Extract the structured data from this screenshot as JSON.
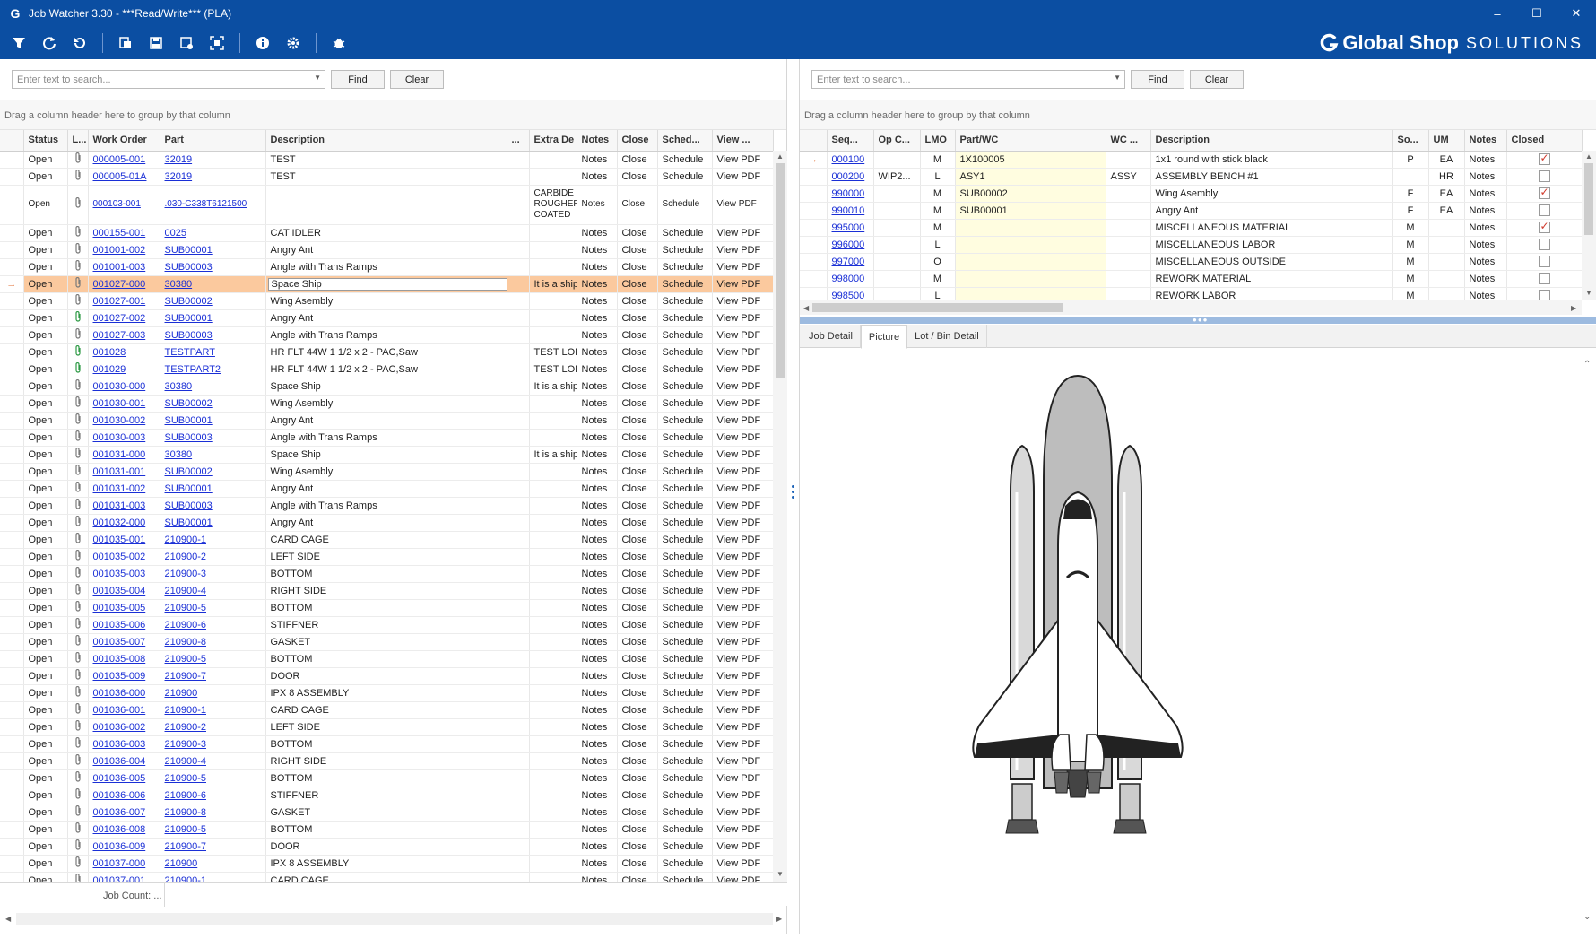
{
  "window": {
    "title": "Job Watcher 3.30 - ***Read/Write*** (PLA)",
    "app_icon": "G",
    "minimize": "–",
    "maximize": "☐",
    "close": "✕"
  },
  "toolbar": {
    "buttons": [
      "filter-icon",
      "refresh-icon",
      "undo-icon",
      "export-icon",
      "save-icon",
      "save-layout-icon",
      "fit-icon",
      "info-icon",
      "settings-icon",
      "bug-icon"
    ]
  },
  "brand": {
    "name": "Global Shop",
    "suffix": "SOLUTIONS"
  },
  "left": {
    "search": {
      "placeholder": "Enter text to search...",
      "find": "Find",
      "clear": "Clear"
    },
    "group_hint": "Drag a column header here to group by that column",
    "columns": [
      "Status",
      "L...",
      "Work Order",
      "Part",
      "Description",
      "...",
      "Extra De",
      "Notes",
      "Close",
      "Sched...",
      "View ..."
    ],
    "rows": [
      {
        "status": "Open",
        "clip": "gray",
        "wo": "000005-001",
        "part": "32019",
        "desc": "TEST",
        "extra": ""
      },
      {
        "status": "Open",
        "clip": "gray",
        "wo": "000005-01A",
        "part": "32019",
        "desc": "TEST",
        "extra": ""
      },
      {
        "status": "Open",
        "clip": "gray",
        "wo": "000103-001",
        "part": ".030-C338T6121500",
        "desc": "",
        "extra": "CARBIDE ROUGHER COATED",
        "tall": true
      },
      {
        "status": "Open",
        "clip": "gray",
        "wo": "000155-001",
        "part": "0025",
        "desc": "CAT IDLER",
        "extra": ""
      },
      {
        "status": "Open",
        "clip": "gray",
        "wo": "001001-002",
        "part": "SUB00001",
        "desc": "Angry Ant",
        "extra": ""
      },
      {
        "status": "Open",
        "clip": "gray",
        "wo": "001001-003",
        "part": "SUB00003",
        "desc": "Angle with Trans Ramps",
        "extra": ""
      },
      {
        "status": "Open",
        "clip": "gray",
        "wo": "001027-000",
        "part": "30380",
        "desc": "Space Ship",
        "extra": "It is a ship",
        "sel": true
      },
      {
        "status": "Open",
        "clip": "gray",
        "wo": "001027-001",
        "part": "SUB00002",
        "desc": "Wing Asembly",
        "extra": ""
      },
      {
        "status": "Open",
        "clip": "green",
        "wo": "001027-002",
        "part": "SUB00001",
        "desc": "Angry Ant",
        "extra": ""
      },
      {
        "status": "Open",
        "clip": "gray",
        "wo": "001027-003",
        "part": "SUB00003",
        "desc": "Angle with Trans Ramps",
        "extra": ""
      },
      {
        "status": "Open",
        "clip": "green",
        "wo": "001028",
        "part": "TESTPART",
        "desc": "HR FLT 44W 1 1/2 x 2 - PAC,Saw",
        "extra": "TEST LONG"
      },
      {
        "status": "Open",
        "clip": "green",
        "wo": "001029",
        "part": "TESTPART2",
        "desc": "HR FLT 44W 1 1/2 x 2 - PAC,Saw",
        "extra": "TEST LONG"
      },
      {
        "status": "Open",
        "clip": "gray",
        "wo": "001030-000",
        "part": "30380",
        "desc": "Space Ship",
        "extra": "It is a ship"
      },
      {
        "status": "Open",
        "clip": "gray",
        "wo": "001030-001",
        "part": "SUB00002",
        "desc": "Wing Asembly",
        "extra": ""
      },
      {
        "status": "Open",
        "clip": "gray",
        "wo": "001030-002",
        "part": "SUB00001",
        "desc": "Angry Ant",
        "extra": ""
      },
      {
        "status": "Open",
        "clip": "gray",
        "wo": "001030-003",
        "part": "SUB00003",
        "desc": "Angle with Trans Ramps",
        "extra": ""
      },
      {
        "status": "Open",
        "clip": "gray",
        "wo": "001031-000",
        "part": "30380",
        "desc": "Space Ship",
        "extra": "It is a ship"
      },
      {
        "status": "Open",
        "clip": "gray",
        "wo": "001031-001",
        "part": "SUB00002",
        "desc": "Wing Asembly",
        "extra": ""
      },
      {
        "status": "Open",
        "clip": "gray",
        "wo": "001031-002",
        "part": "SUB00001",
        "desc": "Angry Ant",
        "extra": ""
      },
      {
        "status": "Open",
        "clip": "gray",
        "wo": "001031-003",
        "part": "SUB00003",
        "desc": "Angle with Trans Ramps",
        "extra": ""
      },
      {
        "status": "Open",
        "clip": "gray",
        "wo": "001032-000",
        "part": "SUB00001",
        "desc": "Angry Ant",
        "extra": ""
      },
      {
        "status": "Open",
        "clip": "gray",
        "wo": "001035-001",
        "part": "210900-1",
        "desc": "CARD CAGE",
        "extra": ""
      },
      {
        "status": "Open",
        "clip": "gray",
        "wo": "001035-002",
        "part": "210900-2",
        "desc": "LEFT SIDE",
        "extra": ""
      },
      {
        "status": "Open",
        "clip": "gray",
        "wo": "001035-003",
        "part": "210900-3",
        "desc": "BOTTOM",
        "extra": ""
      },
      {
        "status": "Open",
        "clip": "gray",
        "wo": "001035-004",
        "part": "210900-4",
        "desc": "RIGHT SIDE",
        "extra": ""
      },
      {
        "status": "Open",
        "clip": "gray",
        "wo": "001035-005",
        "part": "210900-5",
        "desc": "BOTTOM",
        "extra": ""
      },
      {
        "status": "Open",
        "clip": "gray",
        "wo": "001035-006",
        "part": "210900-6",
        "desc": "STIFFNER",
        "extra": ""
      },
      {
        "status": "Open",
        "clip": "gray",
        "wo": "001035-007",
        "part": "210900-8",
        "desc": "GASKET",
        "extra": ""
      },
      {
        "status": "Open",
        "clip": "gray",
        "wo": "001035-008",
        "part": "210900-5",
        "desc": "BOTTOM",
        "extra": ""
      },
      {
        "status": "Open",
        "clip": "gray",
        "wo": "001035-009",
        "part": "210900-7",
        "desc": "DOOR",
        "extra": ""
      },
      {
        "status": "Open",
        "clip": "gray",
        "wo": "001036-000",
        "part": "210900",
        "desc": "IPX 8 ASSEMBLY",
        "extra": ""
      },
      {
        "status": "Open",
        "clip": "gray",
        "wo": "001036-001",
        "part": "210900-1",
        "desc": "CARD CAGE",
        "extra": ""
      },
      {
        "status": "Open",
        "clip": "gray",
        "wo": "001036-002",
        "part": "210900-2",
        "desc": "LEFT SIDE",
        "extra": ""
      },
      {
        "status": "Open",
        "clip": "gray",
        "wo": "001036-003",
        "part": "210900-3",
        "desc": "BOTTOM",
        "extra": ""
      },
      {
        "status": "Open",
        "clip": "gray",
        "wo": "001036-004",
        "part": "210900-4",
        "desc": "RIGHT SIDE",
        "extra": ""
      },
      {
        "status": "Open",
        "clip": "gray",
        "wo": "001036-005",
        "part": "210900-5",
        "desc": "BOTTOM",
        "extra": ""
      },
      {
        "status": "Open",
        "clip": "gray",
        "wo": "001036-006",
        "part": "210900-6",
        "desc": "STIFFNER",
        "extra": ""
      },
      {
        "status": "Open",
        "clip": "gray",
        "wo": "001036-007",
        "part": "210900-8",
        "desc": "GASKET",
        "extra": ""
      },
      {
        "status": "Open",
        "clip": "gray",
        "wo": "001036-008",
        "part": "210900-5",
        "desc": "BOTTOM",
        "extra": ""
      },
      {
        "status": "Open",
        "clip": "gray",
        "wo": "001036-009",
        "part": "210900-7",
        "desc": "DOOR",
        "extra": ""
      },
      {
        "status": "Open",
        "clip": "gray",
        "wo": "001037-000",
        "part": "210900",
        "desc": "IPX 8 ASSEMBLY",
        "extra": ""
      },
      {
        "status": "Open",
        "clip": "gray",
        "wo": "001037-001",
        "part": "210900-1",
        "desc": "CARD CAGE",
        "extra": ""
      }
    ],
    "row_actions": {
      "notes": "Notes",
      "close": "Close",
      "schedule": "Schedule",
      "view": "View PDF"
    },
    "footer": {
      "job_count": "Job Count: ..."
    }
  },
  "right": {
    "search": {
      "placeholder": "Enter text to search...",
      "find": "Find",
      "clear": "Clear"
    },
    "group_hint": "Drag a column header here to group by that column",
    "columns": [
      "Seq...",
      "Op C...",
      "LMO",
      "Part/WC",
      "WC ...",
      "Description",
      "So...",
      "UM",
      "Notes",
      "Closed"
    ],
    "rows": [
      {
        "seq": "000100",
        "opc": "",
        "lmo": "M",
        "partwc": "1X100005",
        "wc": "",
        "desc": "1x1 round with stick black",
        "so": "P",
        "um": "EA",
        "closed": true,
        "current": true
      },
      {
        "seq": "000200",
        "opc": "WIP2...",
        "lmo": "L",
        "partwc": "ASY1",
        "wc": "ASSY",
        "desc": "ASSEMBLY BENCH #1",
        "so": "",
        "um": "HR",
        "closed": false
      },
      {
        "seq": "990000",
        "opc": "",
        "lmo": "M",
        "partwc": "SUB00002",
        "wc": "",
        "desc": "Wing Asembly",
        "so": "F",
        "um": "EA",
        "closed": true
      },
      {
        "seq": "990010",
        "opc": "",
        "lmo": "M",
        "partwc": "SUB00001",
        "wc": "",
        "desc": "Angry Ant",
        "so": "F",
        "um": "EA",
        "closed": false
      },
      {
        "seq": "995000",
        "opc": "",
        "lmo": "M",
        "partwc": "",
        "wc": "",
        "desc": "MISCELLANEOUS MATERIAL",
        "so": "M",
        "um": "",
        "closed": true
      },
      {
        "seq": "996000",
        "opc": "",
        "lmo": "L",
        "partwc": "",
        "wc": "",
        "desc": "MISCELLANEOUS LABOR",
        "so": "M",
        "um": "",
        "closed": false
      },
      {
        "seq": "997000",
        "opc": "",
        "lmo": "O",
        "partwc": "",
        "wc": "",
        "desc": "MISCELLANEOUS OUTSIDE",
        "so": "M",
        "um": "",
        "closed": false
      },
      {
        "seq": "998000",
        "opc": "",
        "lmo": "M",
        "partwc": "",
        "wc": "",
        "desc": "REWORK MATERIAL",
        "so": "M",
        "um": "",
        "closed": false
      },
      {
        "seq": "998500",
        "opc": "",
        "lmo": "L",
        "partwc": "",
        "wc": "",
        "desc": "REWORK LABOR",
        "so": "M",
        "um": "",
        "closed": false
      }
    ],
    "notes_label": "Notes",
    "tabs": [
      {
        "label": "Job Detail",
        "active": false
      },
      {
        "label": "Picture",
        "active": true
      },
      {
        "label": "Lot / Bin Detail",
        "active": false
      }
    ],
    "picture": {
      "subject": "space-shuttle-image"
    }
  }
}
